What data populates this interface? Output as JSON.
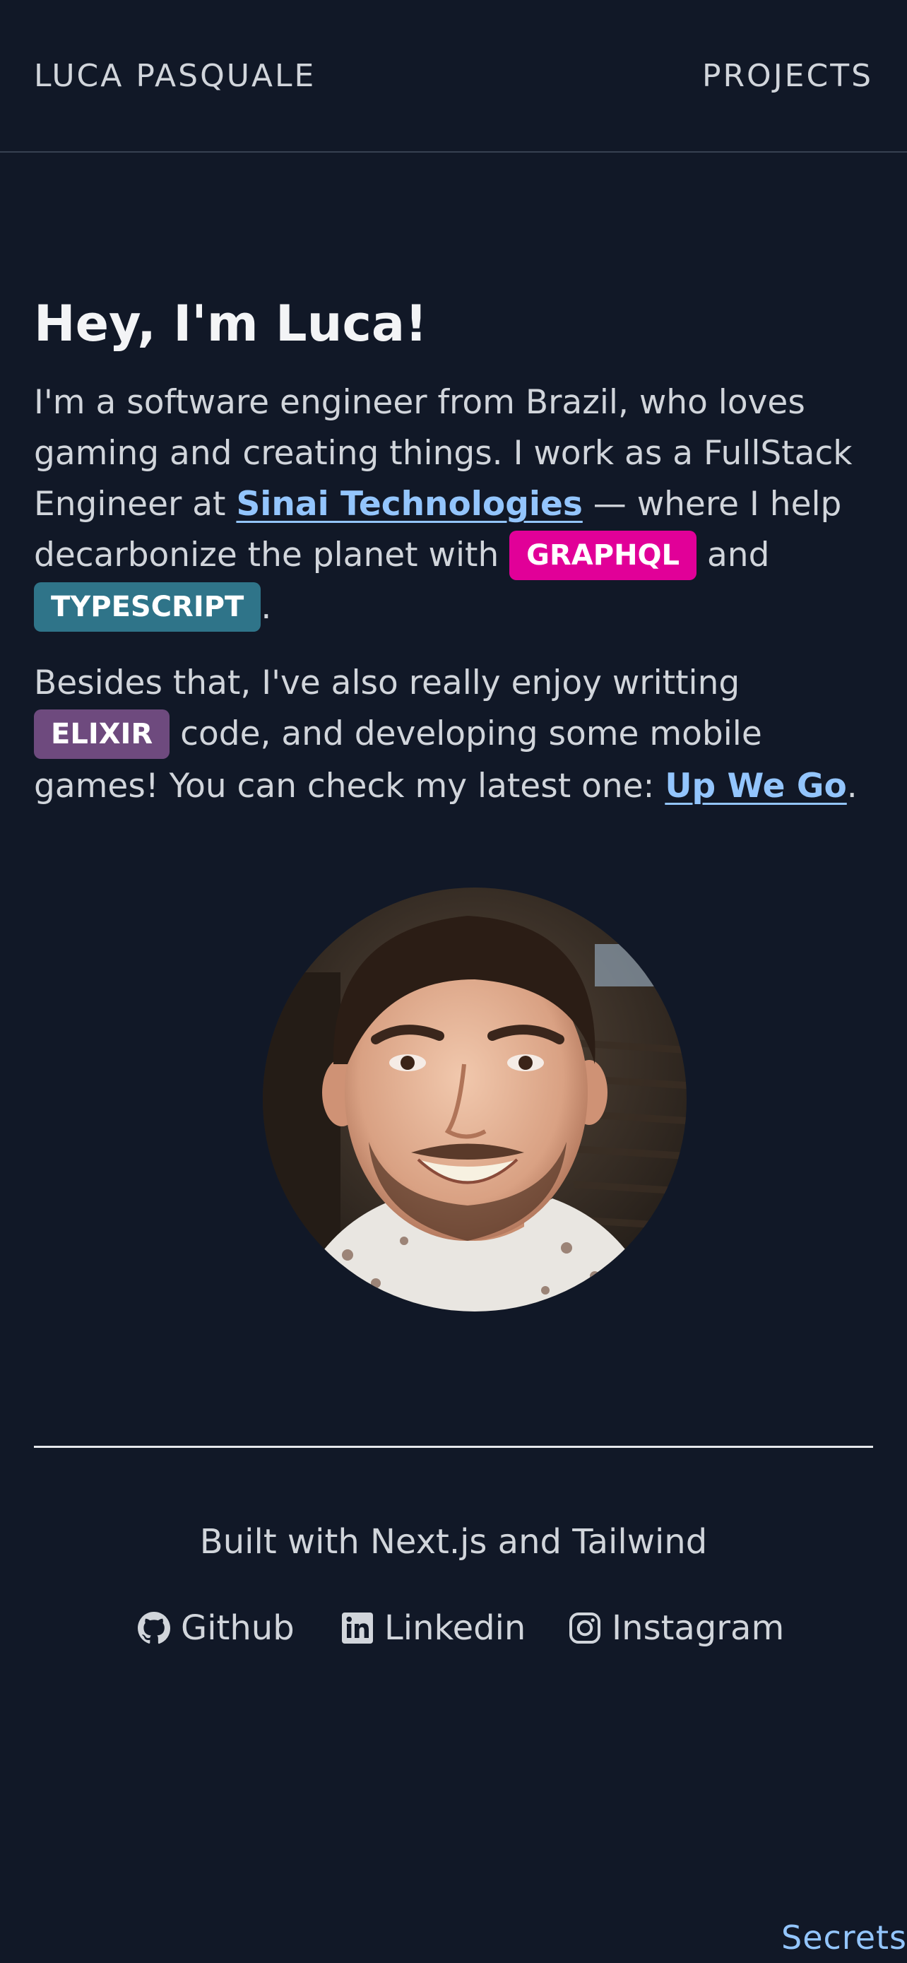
{
  "header": {
    "brand": "LUCA PASQUALE",
    "nav_projects": "PROJECTS"
  },
  "intro": {
    "heading": "Hey, I'm Luca!",
    "p1_part1": "I'm a software engineer from Brazil, who loves gaming and creating things. I work as a FullStack Engineer at ",
    "company_link": "Sinai Technologies",
    "p1_part2": " — where I help decarbonize the planet with ",
    "badge_graphql": "GRAPHQL",
    "p1_part3": " and ",
    "badge_typescript": "TYPESCRIPT",
    "p1_end": ".",
    "p2_part1": "Besides that, I've also really enjoy writting ",
    "badge_elixir": "ELIXIR",
    "p2_part2": " code, and developing some mobile games! You can check my latest one: ",
    "game_link": "Up We Go",
    "p2_end": "."
  },
  "colors": {
    "background": "#111827",
    "link": "#93c5fd",
    "graphql": "#e10098",
    "typescript": "#2f7489",
    "elixir": "#6e4a7e"
  },
  "footer": {
    "built_with": "Built with Next.js and Tailwind",
    "links": [
      {
        "label": "Github",
        "icon": "github-icon"
      },
      {
        "label": "Linkedin",
        "icon": "linkedin-icon"
      },
      {
        "label": "Instagram",
        "icon": "instagram-icon"
      }
    ],
    "secrets": "Secrets"
  }
}
